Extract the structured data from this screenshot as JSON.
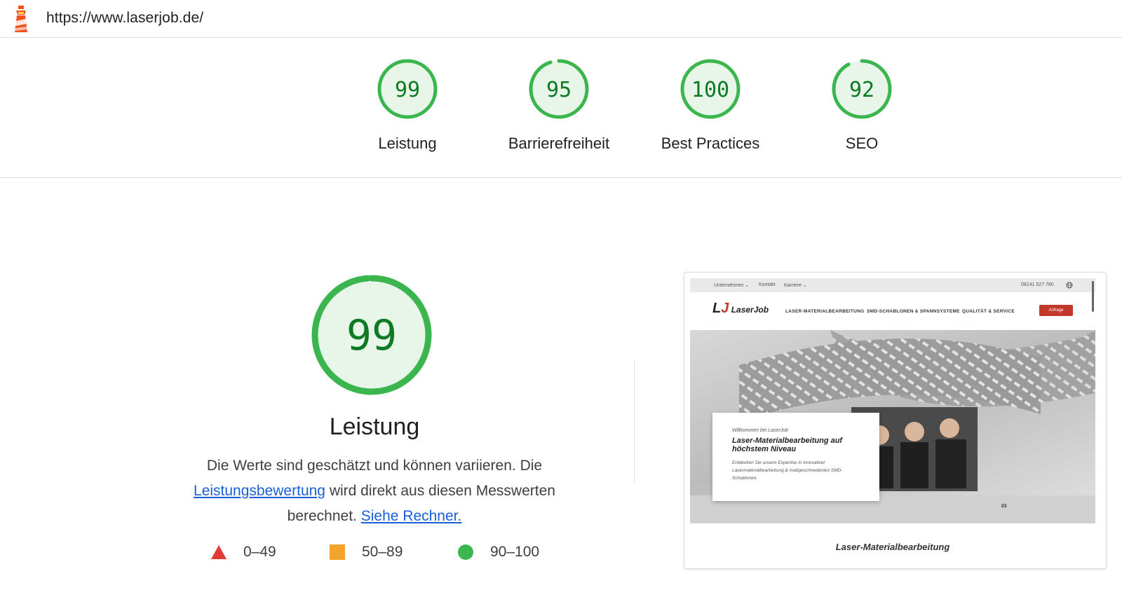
{
  "header": {
    "url": "https://www.laserjob.de/",
    "logo_icon": "lighthouse-icon"
  },
  "categories": [
    {
      "label": "Leistung",
      "score": 99
    },
    {
      "label": "Barrierefreiheit",
      "score": 95
    },
    {
      "label": "Best Practices",
      "score": 100
    },
    {
      "label": "SEO",
      "score": 92
    }
  ],
  "performance": {
    "score": 99,
    "title": "Leistung",
    "desc_part1": "Die Werte sind geschätzt und können variieren. Die",
    "link1": "Leistungsbewertung",
    "desc_part2": "wird direkt aus diesen Messwerten berechnet.",
    "link2": "Siehe Rechner."
  },
  "legend": [
    {
      "range": "0–49",
      "icon": "fail-triangle-icon",
      "color": "#e53935"
    },
    {
      "range": "50–89",
      "icon": "average-square-icon",
      "color": "#f4a42b"
    },
    {
      "range": "90–100",
      "icon": "pass-circle-icon",
      "color": "#3bb64e"
    }
  ],
  "screenshot": {
    "topnav": [
      "Unternehmen ⌄",
      "Kontakt",
      "Karriere ⌄",
      "08141 527 780"
    ],
    "logo": "LaserJob",
    "nav": [
      "LASER-MATERIALBEARBEITUNG",
      "SMD-SCHABLONEN & SPANNSYSTEME",
      "QUALITÄT & SERVICE"
    ],
    "button": "Anfrage",
    "card_kicker": "Willkommen bei LaserJob",
    "card_heading": "Laser-Materialbearbeitung auf höchstem Niveau",
    "card_text": "Entdecken Sie unsere Expertise in innovativer Lasermaterialbearbeitung & maßgeschneiderten SMD-Schablonen.",
    "slide_indicator": "01",
    "section_title": "Laser-Materialbearbeitung"
  },
  "colors": {
    "pass": "#0d7a24",
    "pass_ring": "#3bb64e",
    "pass_fill": "#e8f5e9",
    "link": "#1a5fd9"
  }
}
